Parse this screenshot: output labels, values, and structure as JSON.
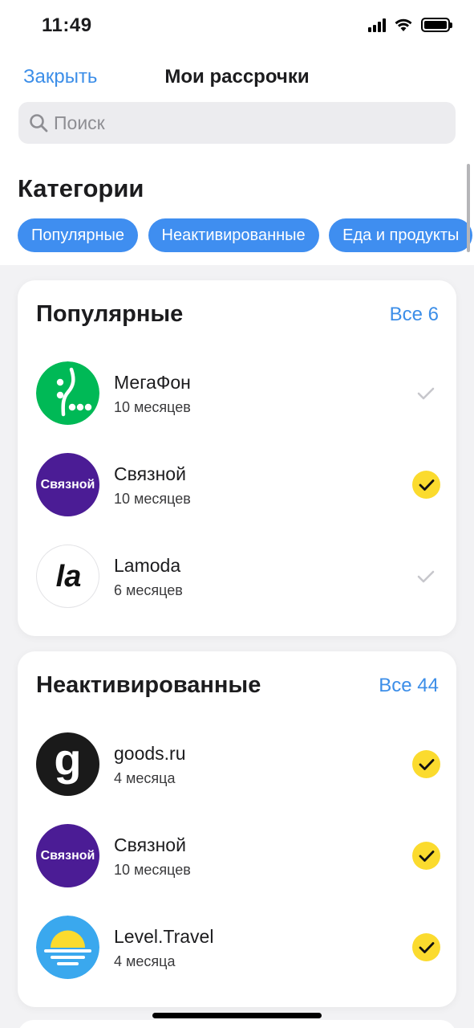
{
  "status_bar": {
    "time": "11:49"
  },
  "nav": {
    "close_label": "Закрыть",
    "title": "Мои рассрочки"
  },
  "search": {
    "placeholder": "Поиск",
    "value": ""
  },
  "categories": {
    "title": "Категории",
    "chips": [
      "Популярные",
      "Неактивированные",
      "Еда и продукты"
    ]
  },
  "sections": [
    {
      "title": "Популярные",
      "all_label": "Все 6",
      "items": [
        {
          "name": "МегаФон",
          "term": "10 месяцев",
          "selected": false,
          "logo": "megafon-logo"
        },
        {
          "name": "Связной",
          "term": "10 месяцев",
          "selected": true,
          "logo": "svyaznoy-logo",
          "logo_text": "Связной"
        },
        {
          "name": "Lamoda",
          "term": "6 месяцев",
          "selected": false,
          "logo": "lamoda-logo",
          "logo_text": "la"
        }
      ]
    },
    {
      "title": "Неактивированные",
      "all_label": "Все 44",
      "items": [
        {
          "name": "goods.ru",
          "term": "4 месяца",
          "selected": true,
          "logo": "goods-logo",
          "logo_text": "g"
        },
        {
          "name": "Связной",
          "term": "10 месяцев",
          "selected": true,
          "logo": "svyaznoy-logo",
          "logo_text": "Связной"
        },
        {
          "name": "Level.Travel",
          "term": "4 месяца",
          "selected": true,
          "logo": "level-travel-logo"
        }
      ]
    }
  ],
  "colors": {
    "accent": "#3c8ee8",
    "chip": "#3f8ef0",
    "check": "#fbdb2e",
    "megafon": "#00b956",
    "svyaznoy": "#4b1c95",
    "goods": "#1a1a1a",
    "level_travel": "#3aa8ee"
  }
}
